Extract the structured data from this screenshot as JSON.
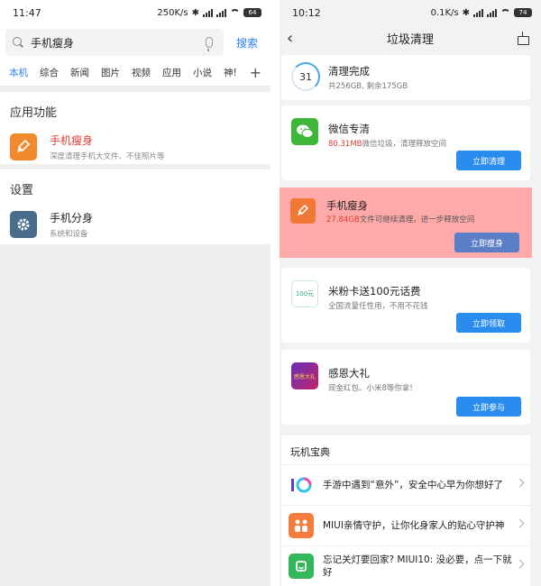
{
  "colors": {
    "accent": "#2b7ff0",
    "button": "#2b8cf0",
    "highlight": "#ffaaaa",
    "red_text": "#e03c30",
    "orange_icon": "#f07a35",
    "wechat_green": "#3db639"
  },
  "left": {
    "status": {
      "time": "11:47",
      "speed": "250K/s",
      "battery": "64"
    },
    "search": {
      "value": "手机瘦身",
      "button": "搜索"
    },
    "tabs": [
      "本机",
      "综合",
      "新闻",
      "图片",
      "视频",
      "应用",
      "小说",
      "神!"
    ],
    "plus": "+",
    "features": {
      "title": "应用功能",
      "item": {
        "name": "手机瘦身",
        "desc": "深度清理手机大文件、不佳照片等",
        "icon": "broom-icon"
      }
    },
    "settings": {
      "title": "设置",
      "item": {
        "name": "手机分身",
        "desc": "系统和设备",
        "icon": "gear-icon"
      }
    }
  },
  "right": {
    "status": {
      "time": "10:12",
      "speed": "0.1K/s",
      "battery": "74"
    },
    "nav": {
      "back": "‹",
      "title": "垃圾清理"
    },
    "summary": {
      "number": "31",
      "title": "清理完成",
      "desc": "共256GB, 剩余175GB"
    },
    "wechat": {
      "title": "微信专清",
      "amount": "80.31MB",
      "desc": "微信垃圾，清理释放空间",
      "button": "立即清理"
    },
    "slim": {
      "title": "手机瘦身",
      "amount": "27.84GB",
      "desc": "文件可继续清理，进一步释放空间",
      "button": "立即瘦身"
    },
    "mifen": {
      "title": "米粉卡送100元话费",
      "desc": "全国流量任性用，不用不花钱",
      "button": "立即领取",
      "icon_text": "100元"
    },
    "gift": {
      "title": "感恩大礼",
      "desc": "现金红包、小米8等你拿!",
      "button": "立即参与",
      "icon_text": "感恩大礼"
    },
    "guide": {
      "title": "玩机宝典",
      "items": [
        {
          "text": "手游中遇到“意外”，安全中心早为你想好了",
          "icon": "miui10-icon"
        },
        {
          "text": "MIUI亲情守护，让你化身家人的贴心守护神",
          "icon": "family-icon"
        },
        {
          "text": "忘记关灯要回家? MIUI10: 没必要，点一下就好",
          "icon": "mijia-icon"
        }
      ]
    }
  }
}
